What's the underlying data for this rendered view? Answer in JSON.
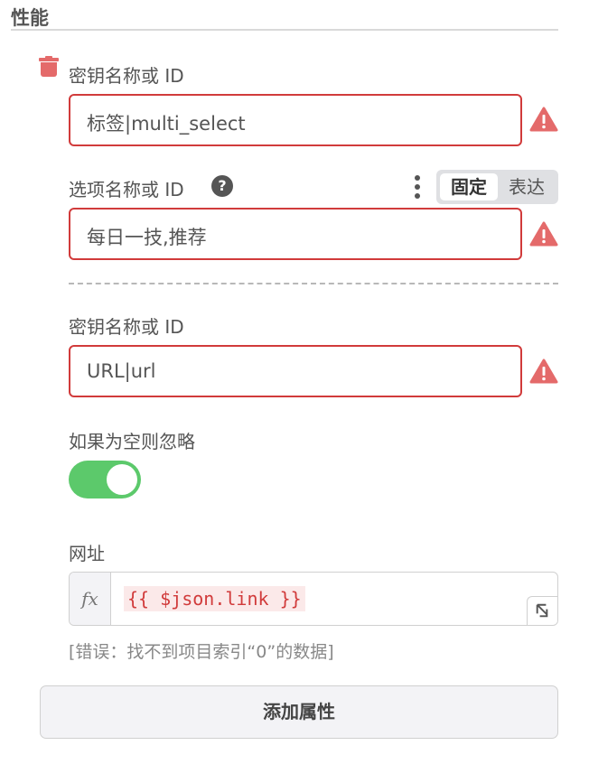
{
  "section": {
    "title": "性能"
  },
  "properties": [
    {
      "key_label": "密钥名称或 ID",
      "key_value": "标签|multi_select",
      "value_label": "选项名称或 ID",
      "value_value": "每日一技,推荐",
      "mode_toggle": {
        "options": [
          "固定",
          "表达"
        ],
        "selected": "固定"
      }
    },
    {
      "key_label": "密钥名称或 ID",
      "key_value": "URL|url",
      "ignore_label": "如果为空则忽略",
      "ignore_enabled": true,
      "url_label": "网址",
      "url_expression": "{{ $json.link }}",
      "url_error": "[错误：找不到项目索引“0”的数据]"
    }
  ],
  "expression": {
    "fx_label": "fx"
  },
  "add_button": {
    "label": "添加属性"
  },
  "colors": {
    "error_red": "#d13b3b",
    "warning_icon": "#e46a6a",
    "toggle_on": "#5cc96b"
  },
  "icons": [
    "trash-icon",
    "warning-icon",
    "question-circle-icon",
    "kebab-menu-icon",
    "expand-icon"
  ]
}
